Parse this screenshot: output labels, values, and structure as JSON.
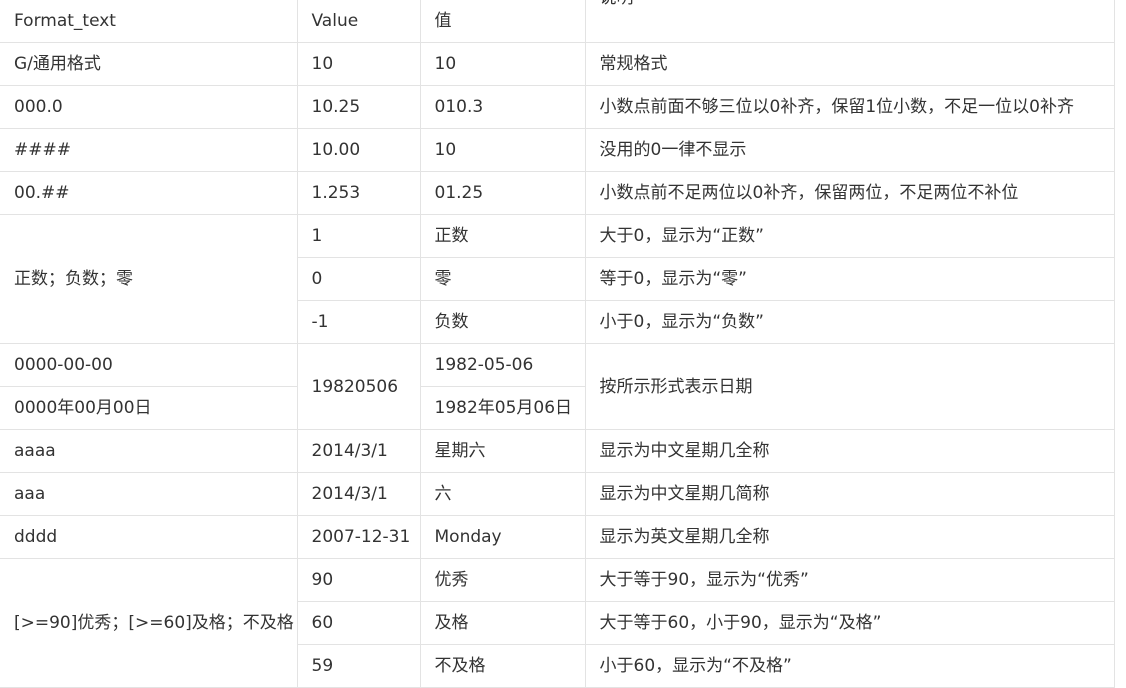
{
  "header": [
    "Format_text",
    "Value",
    "值",
    "说明"
  ],
  "rows": [
    {
      "format": "G/通用格式",
      "value": "10",
      "result": "10",
      "desc": "常规格式"
    },
    {
      "format": "000.0",
      "value": "10.25",
      "result": "010.3",
      "desc": "小数点前面不够三位以0补齐，保留1位小数，不足一位以0补齐"
    },
    {
      "format": "####",
      "value": "10.00",
      "result": "10",
      "desc": "没用的0一律不显示"
    },
    {
      "format": "00.##",
      "value": "1.253",
      "result": "01.25",
      "desc": "小数点前不足两位以0补齐，保留两位，不足两位不补位"
    }
  ],
  "group_sign": {
    "format": "正数；负数；零",
    "rows": [
      {
        "value": "1",
        "result": "正数",
        "desc": "大于0，显示为“正数”"
      },
      {
        "value": "0",
        "result": "零",
        "desc": "等于0，显示为“零”"
      },
      {
        "value": "-1",
        "result": "负数",
        "desc": "小于0，显示为“负数”"
      }
    ]
  },
  "group_date": {
    "formats": [
      "0000-00-00",
      "0000年00月00日"
    ],
    "value": "19820506",
    "results": [
      "1982-05-06",
      "1982年05月06日"
    ],
    "desc": "按所示形式表示日期"
  },
  "rows2": [
    {
      "format": "aaaa",
      "value": "2014/3/1",
      "result": "星期六",
      "desc": "显示为中文星期几全称"
    },
    {
      "format": "aaa",
      "value": "2014/3/1",
      "result": "六",
      "desc": "显示为中文星期几简称"
    },
    {
      "format": "dddd",
      "value": "2007-12-31",
      "result": "Monday",
      "desc": "显示为英文星期几全称"
    }
  ],
  "group_grade": {
    "format": "[>=90]优秀；[>=60]及格；不及格",
    "rows": [
      {
        "value": "90",
        "result": "优秀",
        "desc": "大于等于90，显示为“优秀”"
      },
      {
        "value": "60",
        "result": "及格",
        "desc": "大于等于60，小于90，显示为“及格”"
      },
      {
        "value": "59",
        "result": "不及格",
        "desc": "小于60，显示为“不及格”"
      }
    ]
  }
}
